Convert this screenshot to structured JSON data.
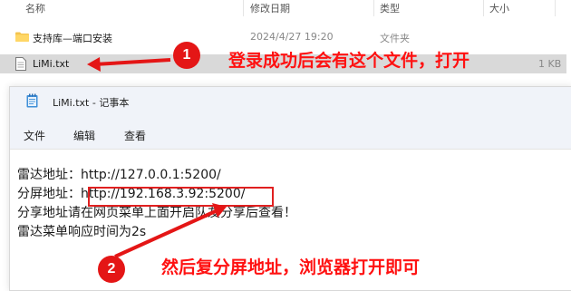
{
  "explorer": {
    "columns": {
      "name": "名称",
      "date": "修改日期",
      "type": "类型",
      "size": "大小"
    },
    "rows": [
      {
        "name": "支持库—端口安装",
        "date": "2024/4/27 19:20",
        "type": "文件夹",
        "size": ""
      },
      {
        "name": "LiMi.txt",
        "date": "",
        "type": "",
        "size": "1 KB"
      }
    ]
  },
  "notepad": {
    "title": "LiMi.txt - 记事本",
    "menu": {
      "file": "文件",
      "edit": "编辑",
      "view": "查看"
    },
    "lines": [
      "雷达地址：http://127.0.0.1:5200/",
      "分屏地址：http://192.168.3.92:5200/",
      "分享地址请在网页菜单上面开启队友分享后查看！",
      "雷达菜单响应时间为2s"
    ]
  },
  "annotations": {
    "badge1": "1",
    "text1": "登录成功后会有这个文件，打开",
    "badge2": "2",
    "text2": "然后复分屏地址，浏览器打开即可",
    "color": "#ff1111"
  }
}
